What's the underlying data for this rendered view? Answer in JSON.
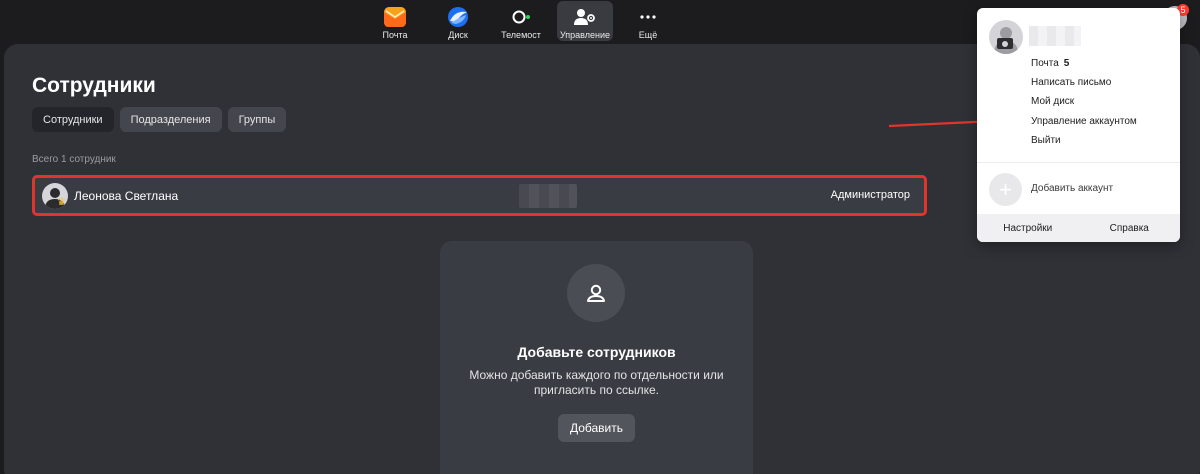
{
  "services": [
    {
      "id": "mail",
      "label": "Почта",
      "icon": "mail-icon"
    },
    {
      "id": "disk",
      "label": "Диск",
      "icon": "disk-icon"
    },
    {
      "id": "telemost",
      "label": "Телемост",
      "icon": "telemost-icon"
    },
    {
      "id": "admin",
      "label": "Управление",
      "icon": "admin-icon"
    },
    {
      "id": "more",
      "label": "Ещё",
      "icon": "more-icon"
    }
  ],
  "page": {
    "title": "Сотрудники",
    "tabs": [
      {
        "label": "Сотрудники",
        "active": true
      },
      {
        "label": "Подразделения",
        "active": false
      },
      {
        "label": "Группы",
        "active": false
      }
    ],
    "count_label": "Всего 1 сотрудник"
  },
  "employees": [
    {
      "name": "Леонова Светлана",
      "role": "Администратор"
    }
  ],
  "empty_card": {
    "title": "Добавьте сотрудников",
    "text": "Можно добавить каждого по отдельности или пригласить по ссылке.",
    "button": "Добавить"
  },
  "account_menu": {
    "badge": "5",
    "items": [
      {
        "label": "Почта",
        "count": "5"
      },
      {
        "label": "Написать письмо"
      },
      {
        "label": "Мой диск"
      },
      {
        "label": "Управление аккаунтом"
      },
      {
        "label": "Выйти"
      }
    ],
    "add_account": "Добавить аккаунт",
    "footer": {
      "settings": "Настройки",
      "help": "Справка"
    }
  },
  "colors": {
    "highlight": "#e0352b",
    "panel": "#2f3137",
    "background": "#1c1c1e"
  }
}
